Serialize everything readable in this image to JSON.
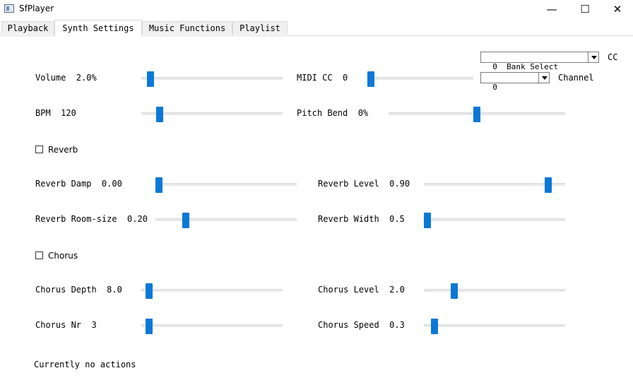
{
  "window": {
    "title": "SfPlayer",
    "minimize": "—",
    "maximize": "☐",
    "close": "✕"
  },
  "tabs": [
    {
      "label": "Playback"
    },
    {
      "label": "Synth Settings"
    },
    {
      "label": "Music Functions"
    },
    {
      "label": "Playlist"
    }
  ],
  "active_tab": "Synth Settings",
  "controls": {
    "cc_combo": {
      "value": "0  Bank Select",
      "label": "CC"
    },
    "channel_combo": {
      "value": "0",
      "label": "Channel"
    },
    "volume": {
      "label": "Volume  2.0%",
      "position": 0.04
    },
    "midi_cc": {
      "label": "MIDI CC  0",
      "position": 0.0
    },
    "bpm": {
      "label": "BPM  120",
      "position": 0.11
    },
    "pitch_bend": {
      "label": "Pitch Bend  0%",
      "position": 0.5
    },
    "reverb_checkbox": {
      "label": "Reverb",
      "checked": false
    },
    "reverb_damp": {
      "label": "Reverb Damp  0.00",
      "position": 0.0
    },
    "reverb_level": {
      "label": "Reverb Level  0.90",
      "position": 0.9
    },
    "reverb_roomsize": {
      "label": "Reverb Room-size  0.20",
      "position": 0.2
    },
    "reverb_width": {
      "label": "Reverb Width  0.5",
      "position": 0.0
    },
    "chorus_checkbox": {
      "label": "Chorus",
      "checked": false
    },
    "chorus_depth": {
      "label": "Chorus Depth  8.0",
      "position": 0.03
    },
    "chorus_level": {
      "label": "Chorus Level  2.0",
      "position": 0.2
    },
    "chorus_nr": {
      "label": "Chorus Nr  3",
      "position": 0.03
    },
    "chorus_speed": {
      "label": "Chorus Speed  0.3",
      "position": 0.05
    }
  },
  "status": {
    "text": "Currently no actions"
  },
  "colors": {
    "accent": "#0a78d7",
    "track": "#e7e7e7",
    "tab_inactive": "#f0f0f0"
  }
}
